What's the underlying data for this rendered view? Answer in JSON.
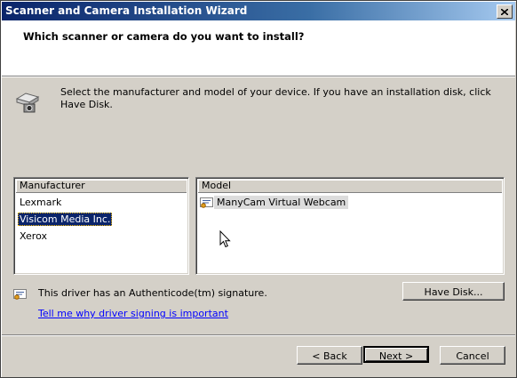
{
  "window": {
    "title": "Scanner and Camera Installation Wizard",
    "close_label": "×"
  },
  "header": {
    "title": "Which scanner or camera do you want to install?"
  },
  "instructions": "Select the manufacturer and model of your device. If you have an installation disk, click Have Disk.",
  "manufacturer_list": {
    "header": "Manufacturer",
    "items": [
      "Lexmark",
      "Visicom Media Inc.",
      "Xerox"
    ],
    "selected": "Visicom Media Inc."
  },
  "model_list": {
    "header": "Model",
    "items": [
      "ManyCam Virtual Webcam"
    ]
  },
  "signature": {
    "text": "This driver has an Authenticode(tm) signature.",
    "link": "Tell me why driver signing is important"
  },
  "buttons": {
    "have_disk": "Have Disk...",
    "back": "< Back",
    "next": "Next >",
    "cancel": "Cancel"
  }
}
